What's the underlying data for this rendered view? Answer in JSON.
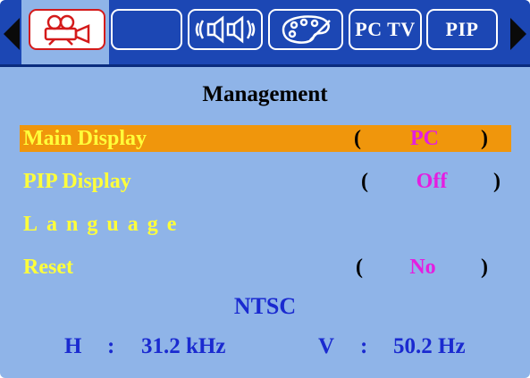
{
  "tabs": {
    "pctv_label": "PC TV",
    "pip_label": "PIP"
  },
  "menu": {
    "title": "Management",
    "items": [
      {
        "label": "Main Display",
        "value": "PC"
      },
      {
        "label": "PIP Display",
        "value": "Off"
      },
      {
        "label": "Language",
        "value": ""
      },
      {
        "label": "Reset",
        "value": "No"
      }
    ]
  },
  "parens": {
    "open": "(",
    "close": ")"
  },
  "signal": {
    "format": "NTSC",
    "h_label": "H",
    "h_sep": ":",
    "h_value": "31.2 kHz",
    "v_label": "V",
    "v_sep": ":",
    "v_value": "50.2 Hz"
  },
  "colors": {
    "tab_bar": "#1c47b4",
    "menu_bg": "#8fb4e8",
    "highlight": "#f0960c",
    "label_yellow": "#ffff3a",
    "value_magenta": "#e41ee0",
    "signal_blue": "#1a2ad0"
  },
  "icons": {
    "tab_video": "projector-icon",
    "tab_audio": "speaker-icon",
    "tab_color": "palette-icon",
    "nav_left": "triangle-left-icon",
    "nav_right": "triangle-right-icon"
  }
}
